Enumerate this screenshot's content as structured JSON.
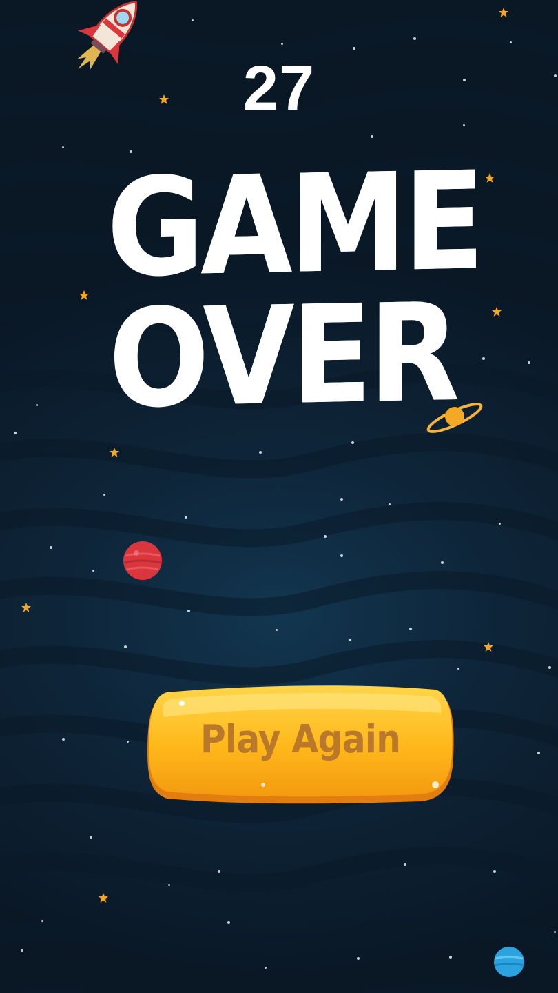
{
  "score": "27",
  "title": {
    "line1": "GAME",
    "line2": "OVER"
  },
  "play_again_button": {
    "label": "Play Again"
  },
  "colors": {
    "background": "#0e2539",
    "button": "#ffb81a",
    "button_text": "#b9782a",
    "star": "#f5a623",
    "red_planet": "#d9363e",
    "blue_planet": "#2aa3e0"
  },
  "icons": [
    "rocket-icon",
    "star-icon",
    "red-planet-icon",
    "blue-planet-icon",
    "ringed-planet-icon"
  ]
}
